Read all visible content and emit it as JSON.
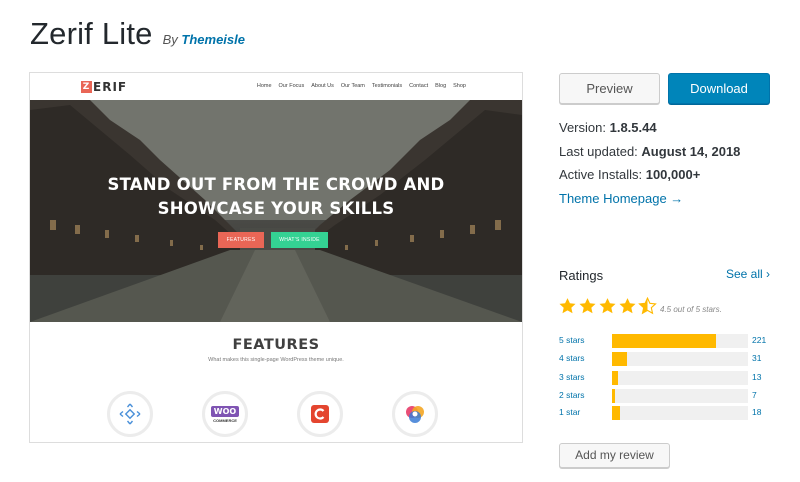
{
  "theme": {
    "name": "Zerif Lite",
    "by_prefix": "By",
    "author": "Themeisle"
  },
  "screenshot": {
    "logo_mark": "Z",
    "logo_rest": "ERIF",
    "nav": [
      "Home",
      "Our Focus",
      "About Us",
      "Our Team",
      "Testimonials",
      "Contact",
      "Blog",
      "Shop"
    ],
    "hero_line1": "STAND OUT FROM THE CROWD AND",
    "hero_line2": "SHOWCASE YOUR SKILLS",
    "btn_features": "FEATURES",
    "btn_inside": "WHAT'S INSIDE",
    "features_title": "FEATURES",
    "features_sub": "What makes this single-page WordPress theme unique.",
    "woo_text": "WOO",
    "woo_sub": "COMMERCE",
    "accent_red": "#e96656",
    "accent_green": "#34d293"
  },
  "actions": {
    "preview": "Preview",
    "download": "Download"
  },
  "meta": {
    "version_label": "Version:",
    "version": "1.8.5.44",
    "updated_label": "Last updated:",
    "updated": "August 14, 2018",
    "installs_label": "Active Installs:",
    "installs": "100,000+",
    "homepage": "Theme Homepage →"
  },
  "ratings": {
    "heading": "Ratings",
    "see_all": "See all ›",
    "average_text": "4.5 out of 5 stars.",
    "average": 4.5,
    "rows": [
      {
        "label": "5 stars",
        "count": "221"
      },
      {
        "label": "4 stars",
        "count": "31"
      },
      {
        "label": "3 stars",
        "count": "13"
      },
      {
        "label": "2 stars",
        "count": "7"
      },
      {
        "label": "1 star",
        "count": "18"
      }
    ],
    "star_color": "#ffb900"
  },
  "review_button": "Add my review"
}
